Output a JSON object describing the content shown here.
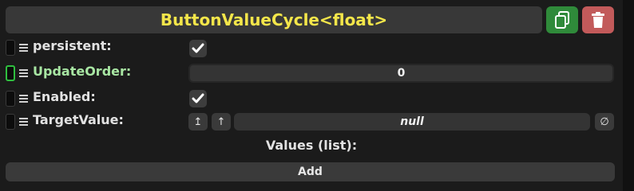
{
  "header": {
    "title": "ButtonValueCycle<float>",
    "duplicate_icon": "duplicate-icon",
    "delete_icon": "trash-icon",
    "duplicate_color": "#2f8a3a",
    "delete_color": "#c25a5a"
  },
  "fields": {
    "persistent": {
      "label": "persistent:",
      "checked": true
    },
    "update_order": {
      "label": "UpdateOrder:",
      "value": "0"
    },
    "enabled": {
      "label": "Enabled:",
      "checked": true
    },
    "target_value": {
      "label": "TargetValue:",
      "value": "null",
      "clear_symbol": "∅",
      "parent_icon": "↥",
      "up_icon": "↑"
    }
  },
  "values_list": {
    "label": "Values (list):",
    "add_label": "Add"
  },
  "colors": {
    "title": "#f4e64a",
    "accent_green": "#2fbf3f"
  }
}
